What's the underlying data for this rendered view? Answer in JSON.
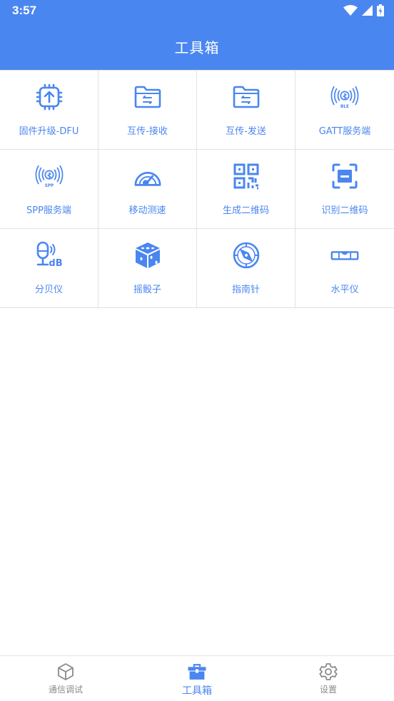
{
  "status": {
    "time": "3:57",
    "icons": [
      "wifi-icon",
      "signal-icon",
      "battery-charging-icon"
    ]
  },
  "header": {
    "title": "工具箱"
  },
  "accent_color": "#4a86f0",
  "tools": [
    {
      "label": "固件升级-DFU",
      "icon": "chip-upload-icon"
    },
    {
      "label": "互传-接收",
      "icon": "folder-receive-icon"
    },
    {
      "label": "互传-发送",
      "icon": "folder-send-icon"
    },
    {
      "label": "GATT服务端",
      "icon": "ble-broadcast-icon",
      "badge": "BLE"
    },
    {
      "label": "SPP服务端",
      "icon": "spp-broadcast-icon",
      "badge": "SPP"
    },
    {
      "label": "移动测速",
      "icon": "speedometer-icon"
    },
    {
      "label": "生成二维码",
      "icon": "qr-code-icon"
    },
    {
      "label": "识别二维码",
      "icon": "scan-icon"
    },
    {
      "label": "分贝仪",
      "icon": "decibel-meter-icon",
      "badge": "dB"
    },
    {
      "label": "摇骰子",
      "icon": "dice-icon"
    },
    {
      "label": "指南针",
      "icon": "compass-icon"
    },
    {
      "label": "水平仪",
      "icon": "spirit-level-icon"
    }
  ],
  "bottom_nav": {
    "items": [
      {
        "label": "通信调试",
        "icon": "cube-icon",
        "active": false
      },
      {
        "label": "工具箱",
        "icon": "toolbox-icon",
        "active": true
      },
      {
        "label": "设置",
        "icon": "settings-gear-icon",
        "active": false
      }
    ]
  }
}
